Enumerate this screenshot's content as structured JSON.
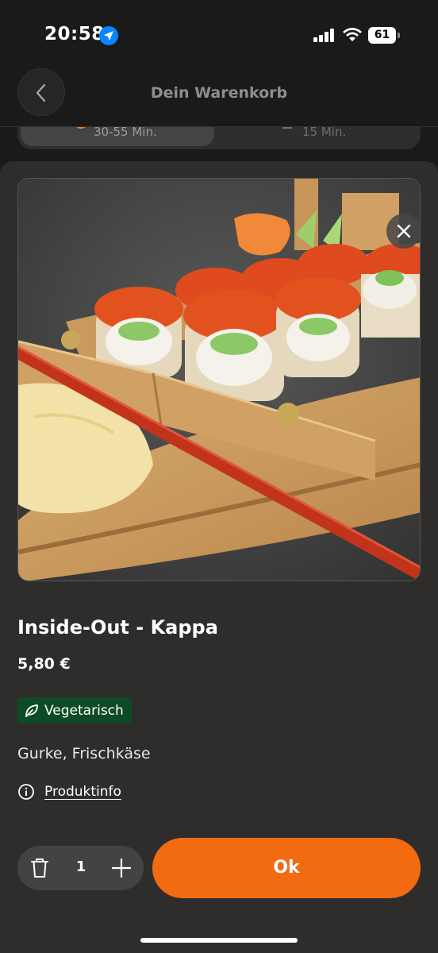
{
  "status_bar": {
    "time": "20:58",
    "battery": "61"
  },
  "header": {
    "title": "Dein Warenkorb"
  },
  "delivery_options": [
    {
      "time": "30-55 Min."
    },
    {
      "time": "15 Min."
    }
  ],
  "product": {
    "name": "Inside-Out - Kappa",
    "price": "5,80 €",
    "badge": "Vegetarisch",
    "ingredients": "Gurke, Frischkäse",
    "info_link": "Produktinfo",
    "image_icon": "sushi-photo"
  },
  "cart_controls": {
    "quantity": "1",
    "ok_label": "Ok"
  },
  "colors": {
    "accent": "#f26b11",
    "badge_bg": "#0d4a26",
    "sheet_bg": "#2f2c2c",
    "page_bg": "#1a1a1a"
  }
}
